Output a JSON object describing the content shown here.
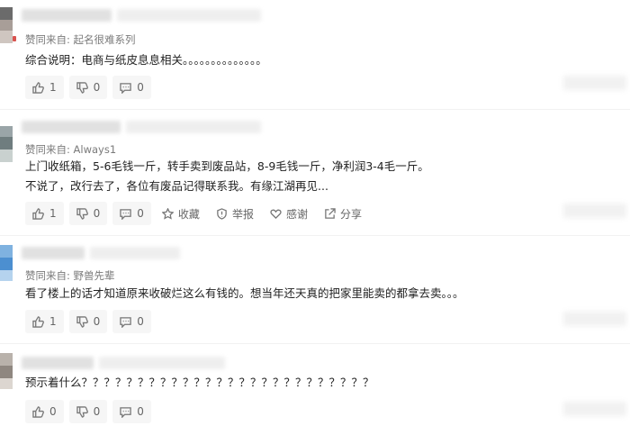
{
  "comments": [
    {
      "source_prefix": "赞同来自: ",
      "source_name": "起名很难系列",
      "text_lines": [
        "综合说明：电商与纸皮息息相关。。。。。。。。。。。。。。"
      ],
      "like_count": "1",
      "dislike_count": "0",
      "reply_count": "0",
      "show_extra": false
    },
    {
      "source_prefix": "赞同来自: ",
      "source_name": "Always1",
      "text_lines": [
        "上门收纸箱，5-6毛钱一斤，转手卖到废品站，8-9毛钱一斤，净利润3-4毛一斤。",
        "不说了，改行去了，各位有废品记得联系我。有缘江湖再见..."
      ],
      "like_count": "1",
      "dislike_count": "0",
      "reply_count": "0",
      "show_extra": true
    },
    {
      "source_prefix": "赞同来自: ",
      "source_name": "野兽先辈",
      "text_lines": [
        "看了楼上的话才知道原来收破烂这么有钱的。想当年还天真的把家里能卖的都拿去卖。。。"
      ],
      "like_count": "1",
      "dislike_count": "0",
      "reply_count": "0",
      "show_extra": false
    },
    {
      "source_prefix": "",
      "source_name": "",
      "text_lines": [
        "预示着什么？？？？？？？？？？？？？？？？？？？？？？？？？？"
      ],
      "like_count": "0",
      "dislike_count": "0",
      "reply_count": "0",
      "show_extra": false
    }
  ],
  "extra_actions": {
    "favorite": "收藏",
    "report": "举报",
    "thanks": "感谢",
    "share": "分享"
  }
}
